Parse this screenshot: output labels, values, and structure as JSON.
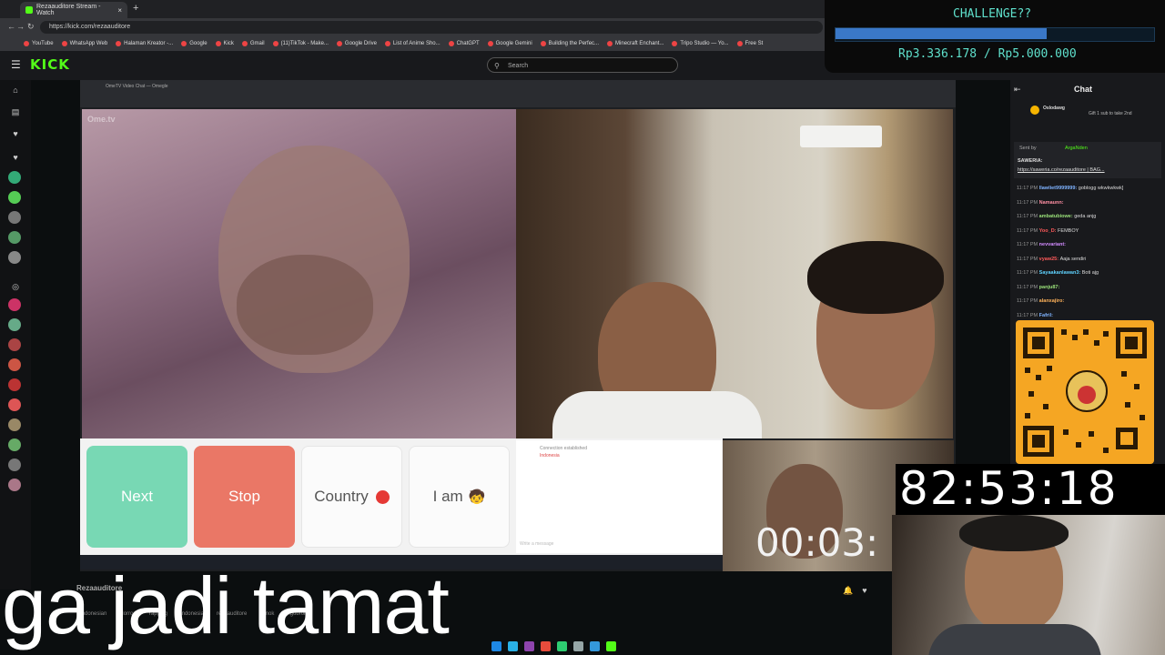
{
  "browser": {
    "tab_title": "Rezaauditore Stream - Watch",
    "tab_close": "×",
    "new_tab": "+",
    "url": "https://kick.com/rezaauditore",
    "back": "←",
    "forward": "→",
    "reload": "↻",
    "bookmarks": [
      "YouTube",
      "WhatsApp Web",
      "Halaman Kreator -...",
      "Google",
      "Kick",
      "Gmail",
      "(11)TikTok - Make...",
      "Google Drive",
      "List of Anime Sho...",
      "ChatGPT",
      "Google Gemini",
      "Building the Perfec...",
      "Minecraft Enchant...",
      "Tripo Studio — Yo...",
      "Free St"
    ]
  },
  "kick": {
    "logo": "KICK",
    "menu_icon": "☰",
    "search_placeholder": "Search"
  },
  "challenge": {
    "title": "CHALLENGE??",
    "amount": "Rp3.336.178 / Rp5.000.000",
    "progress_fraction": 0.667
  },
  "omegle": {
    "watermark": "Ome.tv",
    "chrome_title": "OmeTV Video Chat — Omegle",
    "buttons": {
      "next": "Next",
      "stop": "Stop",
      "country": "Country",
      "iam": "I am"
    },
    "chat_status": "Connection established",
    "chat_country": "Indonesia",
    "chat_placeholder": "Write a message",
    "country_flag_color": "#e53935",
    "iam_emoji": "🧒"
  },
  "timer_small": "00:03:",
  "big_timer": "82:53:18",
  "chat": {
    "title": "Chat",
    "collapse_icon": "⇤",
    "gift_user": "Oslodawg",
    "gift_text": "Gift 1 sub to take 2nd",
    "pinned_sender": "Sent by",
    "pinned_user": "ArgaNden",
    "pinned_label": "SAWERIA:",
    "pinned_link": "https://saweria.co/rezaauditore | BAG...",
    "messages": [
      {
        "time": "11:17 PM",
        "user": "llawliet9999999:",
        "text": "goblogg wkwkwkwk]",
        "color": "#7fb3ff"
      },
      {
        "time": "11:17 PM",
        "user": "Namaunn:",
        "text": "",
        "color": "#ff8fa3"
      },
      {
        "time": "11:17 PM",
        "user": "ambatubiowe:",
        "text": "geda anjg",
        "color": "#9be27a"
      },
      {
        "time": "11:17 PM",
        "user": "Yoo_D:",
        "text": "FEMBOY",
        "color": "#ff5a5a"
      },
      {
        "time": "11:17 PM",
        "user": "nevvariant:",
        "text": "",
        "color": "#d28bff"
      },
      {
        "time": "11:17 PM",
        "user": "vyaw25:",
        "text": "Aaja sendiri",
        "color": "#ff5a5a"
      },
      {
        "time": "11:17 PM",
        "user": "Sayaakanlawan3:",
        "text": "Boti ajg",
        "color": "#5fd3ff"
      },
      {
        "time": "11:17 PM",
        "user": "panju87:",
        "text": "",
        "color": "#9be27a"
      },
      {
        "time": "11:17 PM",
        "user": "alanxajiro:",
        "text": "",
        "color": "#ffb35a"
      },
      {
        "time": "11:17 PM",
        "user": "Fafril:",
        "text": "",
        "color": "#7fb3ff"
      }
    ]
  },
  "stream_info": {
    "streamer": "Rezaauditore",
    "tags": [
      "Indonesian",
      "Horror",
      "Yapping",
      "Indonesia",
      "rezaauditore",
      "jomok",
      "ngobrol"
    ]
  },
  "subtitle": "ga jadi tamat"
}
